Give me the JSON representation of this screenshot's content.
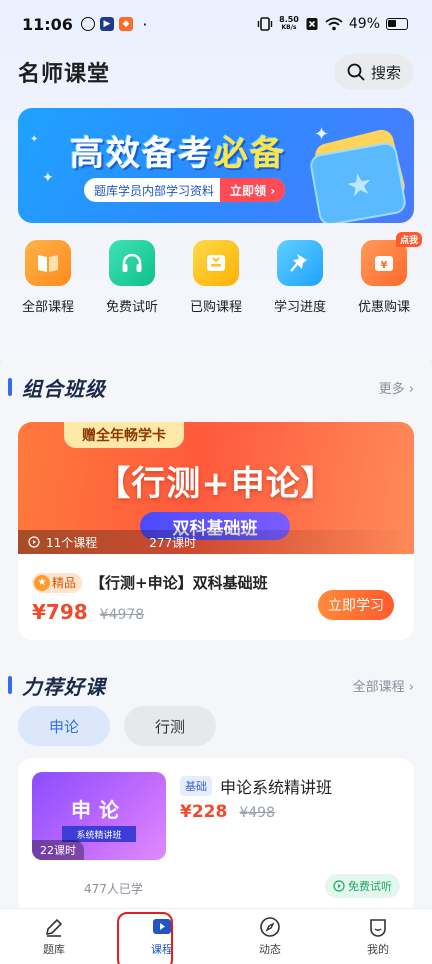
{
  "status": {
    "time": "11:06",
    "net_speed_value": "8.50",
    "net_speed_unit": "KB/s",
    "battery": "49%"
  },
  "header": {
    "title": "名师课堂",
    "search_label": "搜索"
  },
  "banner": {
    "title_a": "高效备考",
    "title_b": "必备",
    "tag": "题库学员内部学习资料",
    "cta": "立即领 ›"
  },
  "quick_nav": [
    {
      "label": "全部课程",
      "color": "#ff9a2b"
    },
    {
      "label": "免费试听",
      "color": "#1fcf9b"
    },
    {
      "label": "已购课程",
      "color": "#ffc21a"
    },
    {
      "label": "学习进度",
      "color": "#2fb4ff"
    },
    {
      "label": "优惠购课",
      "color": "#ff7a3a",
      "badge": "点我"
    }
  ],
  "combo": {
    "title": "组合班级",
    "more": "更多 ›",
    "card": {
      "ribbon": "赠全年畅学卡",
      "cover_title": "【行测+申论】",
      "cover_sub": "双科基础班",
      "lessons": "11个课程",
      "hours": "277课时",
      "badge": "精品",
      "title": "【行测+申论】双科基础班",
      "price": "¥798",
      "original_price": "¥4978",
      "cta": "立即学习"
    }
  },
  "recommend": {
    "title": "力荐好课",
    "more": "全部课程 ›",
    "tabs": [
      {
        "label": "申论",
        "active": true
      },
      {
        "label": "行测",
        "active": false
      }
    ],
    "card": {
      "cover_title": "申论",
      "cover_sub": "系统精讲班",
      "hours": "22课时",
      "tag": "基础",
      "title": "申论系统精讲班",
      "price": "¥228",
      "original_price": "¥498",
      "learners": "477人已学",
      "trial": "免费试听"
    }
  },
  "bottom_nav": [
    {
      "label": "题库",
      "icon": "pencil-icon",
      "active": false
    },
    {
      "label": "课程",
      "icon": "play-icon",
      "active": true
    },
    {
      "label": "动态",
      "icon": "compass-icon",
      "active": false
    },
    {
      "label": "我的",
      "icon": "profile-icon",
      "active": false
    }
  ],
  "colors": {
    "accent": "#2f6ff0",
    "price": "#f04a2b"
  }
}
